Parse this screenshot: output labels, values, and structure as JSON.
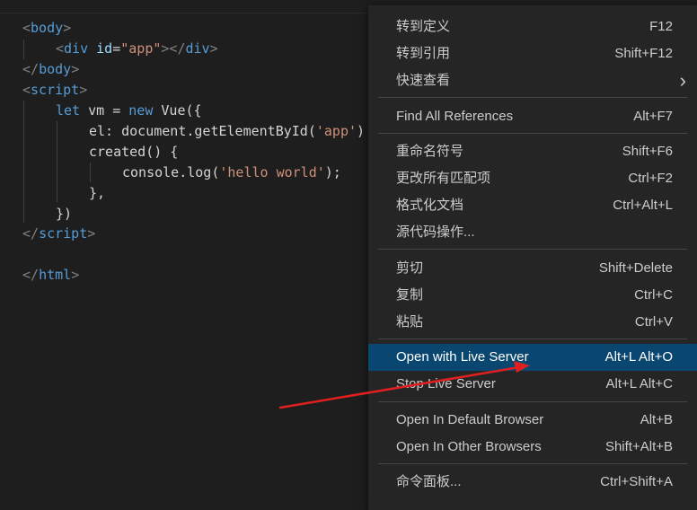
{
  "editor": {
    "lines": [
      {
        "p1": "<",
        "tag": "body",
        "p2": ">"
      },
      {
        "p1": "<",
        "tag": "div",
        "attr": "id",
        "eq": "=",
        "str": "\"app\"",
        "p2": "></",
        "tag2": "div",
        "p3": ">"
      },
      {
        "p1": "</",
        "tag": "body",
        "p2": ">"
      },
      {
        "p1": "<",
        "tag": "script",
        "p2": ">"
      },
      {
        "kw1": "let",
        "t1": " vm = ",
        "kw2": "new",
        "t2": " Vue({"
      },
      {
        "t1": "el: document.getElementById(",
        "str": "'app'",
        "t2": ")"
      },
      {
        "t1": "created() {"
      },
      {
        "t1": "console.log(",
        "str": "'hello world'",
        "t2": ");"
      },
      {
        "t1": "},"
      },
      {
        "t1": "})"
      },
      {
        "p1": "</",
        "tag": "script",
        "p2": ">"
      },
      {
        "p1": "</",
        "tag": "html",
        "p2": ">"
      }
    ]
  },
  "context_menu": {
    "items": [
      {
        "label": "转到定义",
        "shortcut": "F12"
      },
      {
        "label": "转到引用",
        "shortcut": "Shift+F12"
      },
      {
        "label": "快速查看",
        "chevron": "›"
      },
      {
        "label": "Find All References",
        "shortcut": "Alt+F7"
      },
      {
        "label": "重命名符号",
        "shortcut": "Shift+F6"
      },
      {
        "label": "更改所有匹配项",
        "shortcut": "Ctrl+F2"
      },
      {
        "label": "格式化文档",
        "shortcut": "Ctrl+Alt+L"
      },
      {
        "label": "源代码操作..."
      },
      {
        "label": "剪切",
        "shortcut": "Shift+Delete"
      },
      {
        "label": "复制",
        "shortcut": "Ctrl+C"
      },
      {
        "label": "粘贴",
        "shortcut": "Ctrl+V"
      },
      {
        "label": "Open with Live Server",
        "shortcut": "Alt+L Alt+O"
      },
      {
        "label": "Stop Live Server",
        "shortcut": "Alt+L Alt+C"
      },
      {
        "label": "Open In Default Browser",
        "shortcut": "Alt+B"
      },
      {
        "label": "Open In Other Browsers",
        "shortcut": "Shift+Alt+B"
      },
      {
        "label": "命令面板...",
        "shortcut": "Ctrl+Shift+A"
      }
    ],
    "highlight_color": "#094771"
  },
  "annotation": {
    "arrow_color": "#e02020",
    "icon": "red-arrow-annotation"
  }
}
